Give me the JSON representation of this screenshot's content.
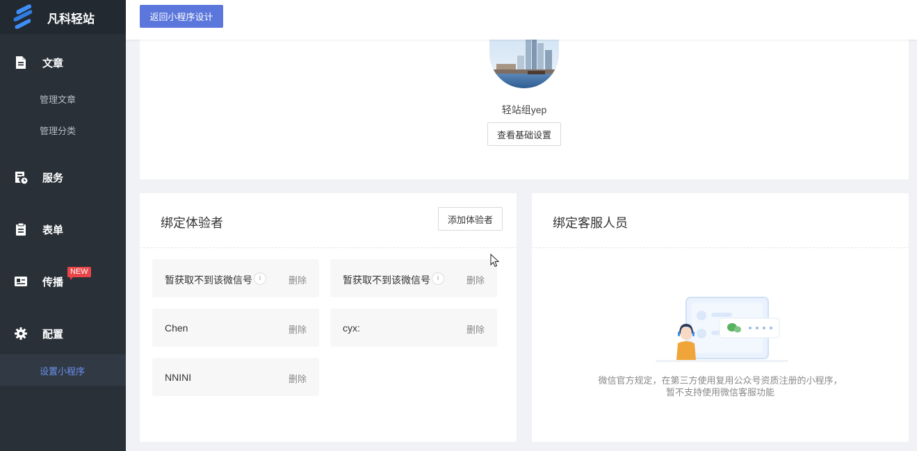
{
  "brand": {
    "name": "凡科轻站",
    "logo": "fanke-logo-icon"
  },
  "sidebar": {
    "items": [
      {
        "label": "文章",
        "icon": "document-icon"
      },
      {
        "label": "管理文章"
      },
      {
        "label": "管理分类"
      },
      {
        "label": "服务",
        "icon": "service-icon"
      },
      {
        "label": "表单",
        "icon": "clipboard-icon"
      },
      {
        "label": "传播",
        "icon": "id-card-icon",
        "badge": "NEW"
      },
      {
        "label": "配置",
        "icon": "gear-icon"
      },
      {
        "label": "设置小程序",
        "active": true
      }
    ]
  },
  "header": {
    "back_label": "返回小程序设计"
  },
  "app_info": {
    "name": "轻站组yep",
    "basic_settings_label": "查看基础设置"
  },
  "testers": {
    "title": "绑定体验者",
    "add_label": "添加体验者",
    "info_glyph": "i",
    "list": [
      {
        "name": "暂获取不到该微信号",
        "info": true,
        "delete": "删除"
      },
      {
        "name": "暂获取不到该微信号",
        "info": true,
        "delete": "删除"
      },
      {
        "name": "Chen",
        "info": false,
        "delete": "删除"
      },
      {
        "name": "cyx:",
        "info": false,
        "delete": "删除"
      },
      {
        "name": "NNINI",
        "info": false,
        "delete": "删除"
      }
    ]
  },
  "customer_service": {
    "title": "绑定客服人员",
    "empty_line1": "微信官方规定，在第三方使用复用公众号资质注册的小程序，",
    "empty_line2": "暂不支持使用微信客服功能"
  },
  "colors": {
    "sidebar_bg": "#293038",
    "accent": "#5b77dc",
    "active_text": "#6c8ff0",
    "badge": "#e84549"
  }
}
